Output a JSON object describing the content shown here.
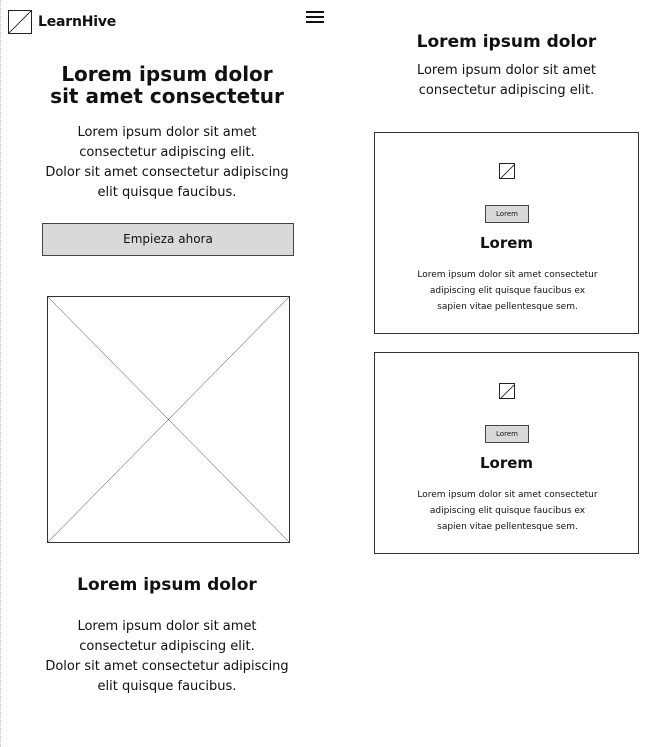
{
  "app": {
    "brand": "LearnHive",
    "logo_icon": "image-placeholder-icon",
    "menu_icon": "hamburger-menu-icon"
  },
  "hero": {
    "title_line1": "Lorem ipsum dolor",
    "title_line2": "sit amet consectetur",
    "text_line1": "Lorem ipsum dolor sit amet",
    "text_line2": "consectetur adipiscing elit.",
    "text_line3": "Dolor sit amet consectetur adipiscing",
    "text_line4": "elit quisque faucibus.",
    "cta_label": "Empieza ahora",
    "image_icon": "image-placeholder-icon"
  },
  "section": {
    "title": "Lorem ipsum dolor",
    "text_line1": "Lorem ipsum dolor sit amet",
    "text_line2": "consectetur adipiscing elit.",
    "text_line3": "Dolor sit amet consectetur adipiscing",
    "text_line4": "elit quisque faucibus."
  },
  "right": {
    "title": "Lorem ipsum dolor",
    "text_line1": "Lorem ipsum dolor sit amet",
    "text_line2": "consectetur adipiscing elit."
  },
  "cards": [
    {
      "icon": "image-placeholder-icon",
      "badge": "Lorem",
      "title": "Lorem",
      "text_line1": "Lorem ipsum dolor sit amet consectetur",
      "text_line2": "adipiscing elit quisque faucibus ex",
      "text_line3": "sapien vitae pellentesque sem."
    },
    {
      "icon": "image-placeholder-icon",
      "badge": "Lorem",
      "title": "Lorem",
      "text_line1": "Lorem ipsum dolor sit amet consectetur",
      "text_line2": "adipiscing elit quisque faucibus ex",
      "text_line3": "sapien vitae pellentesque sem."
    }
  ],
  "colors": {
    "button_fill": "#d9d9d9",
    "border": "#333333",
    "text": "#111111",
    "background": "#ffffff"
  }
}
